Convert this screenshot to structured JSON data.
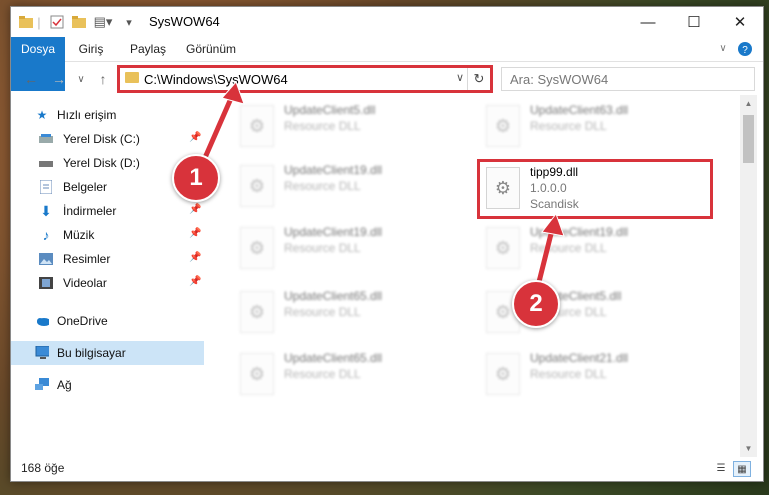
{
  "window": {
    "title": "SysWOW64"
  },
  "window_controls": {
    "minimize": "—",
    "maximize": "☐",
    "close": "✕"
  },
  "ribbon": {
    "tabs": [
      {
        "label": "Dosya"
      },
      {
        "label": "Giriş"
      },
      {
        "label": "Paylaş"
      },
      {
        "label": "Görünüm"
      }
    ]
  },
  "navigation": {
    "path": "C:\\Windows\\SysWOW64",
    "search_placeholder": "Ara: SysWOW64"
  },
  "sidebar": {
    "items": [
      {
        "label": "Hızlı erişim",
        "icon": "star-icon"
      },
      {
        "label": "Yerel Disk (C:)",
        "icon": "drive-icon"
      },
      {
        "label": "Yerel Disk (D:)",
        "icon": "drive-icon"
      },
      {
        "label": "Belgeler",
        "icon": "documents-icon"
      },
      {
        "label": "İndirmeler",
        "icon": "download-icon"
      },
      {
        "label": "Müzik",
        "icon": "music-icon"
      },
      {
        "label": "Resimler",
        "icon": "pictures-icon"
      },
      {
        "label": "Videolar",
        "icon": "video-icon"
      },
      {
        "label": "OneDrive",
        "icon": "cloud-icon"
      },
      {
        "label": "Bu bilgisayar",
        "icon": "computer-icon"
      },
      {
        "label": "Ağ",
        "icon": "network-icon"
      }
    ]
  },
  "files": [
    {
      "name": "UpdateClient5.dll",
      "description": "Resource DLL",
      "company": ""
    },
    {
      "name": "UpdateClient63.dll",
      "description": "Resource DLL",
      "company": ""
    },
    {
      "name": "UpdateClient19.dll",
      "description": "Resource DLL",
      "company": ""
    },
    {
      "name": "tipp99.dll",
      "description": "1.0.0.0",
      "company": "Scandisk"
    },
    {
      "name": "UpdateClient19.dll",
      "description": "Resource DLL",
      "company": ""
    },
    {
      "name": "UpdateClient19.dll",
      "description": "Resource DLL",
      "company": ""
    },
    {
      "name": "UpdateClient65.dll",
      "description": "Resource DLL",
      "company": ""
    },
    {
      "name": "UpdateClient5.dll",
      "description": "Resource DLL",
      "company": ""
    },
    {
      "name": "UpdateClient65.dll",
      "description": "Resource DLL",
      "company": ""
    },
    {
      "name": "UpdateClient21.dll",
      "description": "Resource DLL",
      "company": ""
    }
  ],
  "status": {
    "item_count": "168 öğe"
  },
  "callouts": {
    "one": "1",
    "two": "2"
  },
  "colors": {
    "accent": "#1979ca",
    "annotation": "#d8333b"
  }
}
